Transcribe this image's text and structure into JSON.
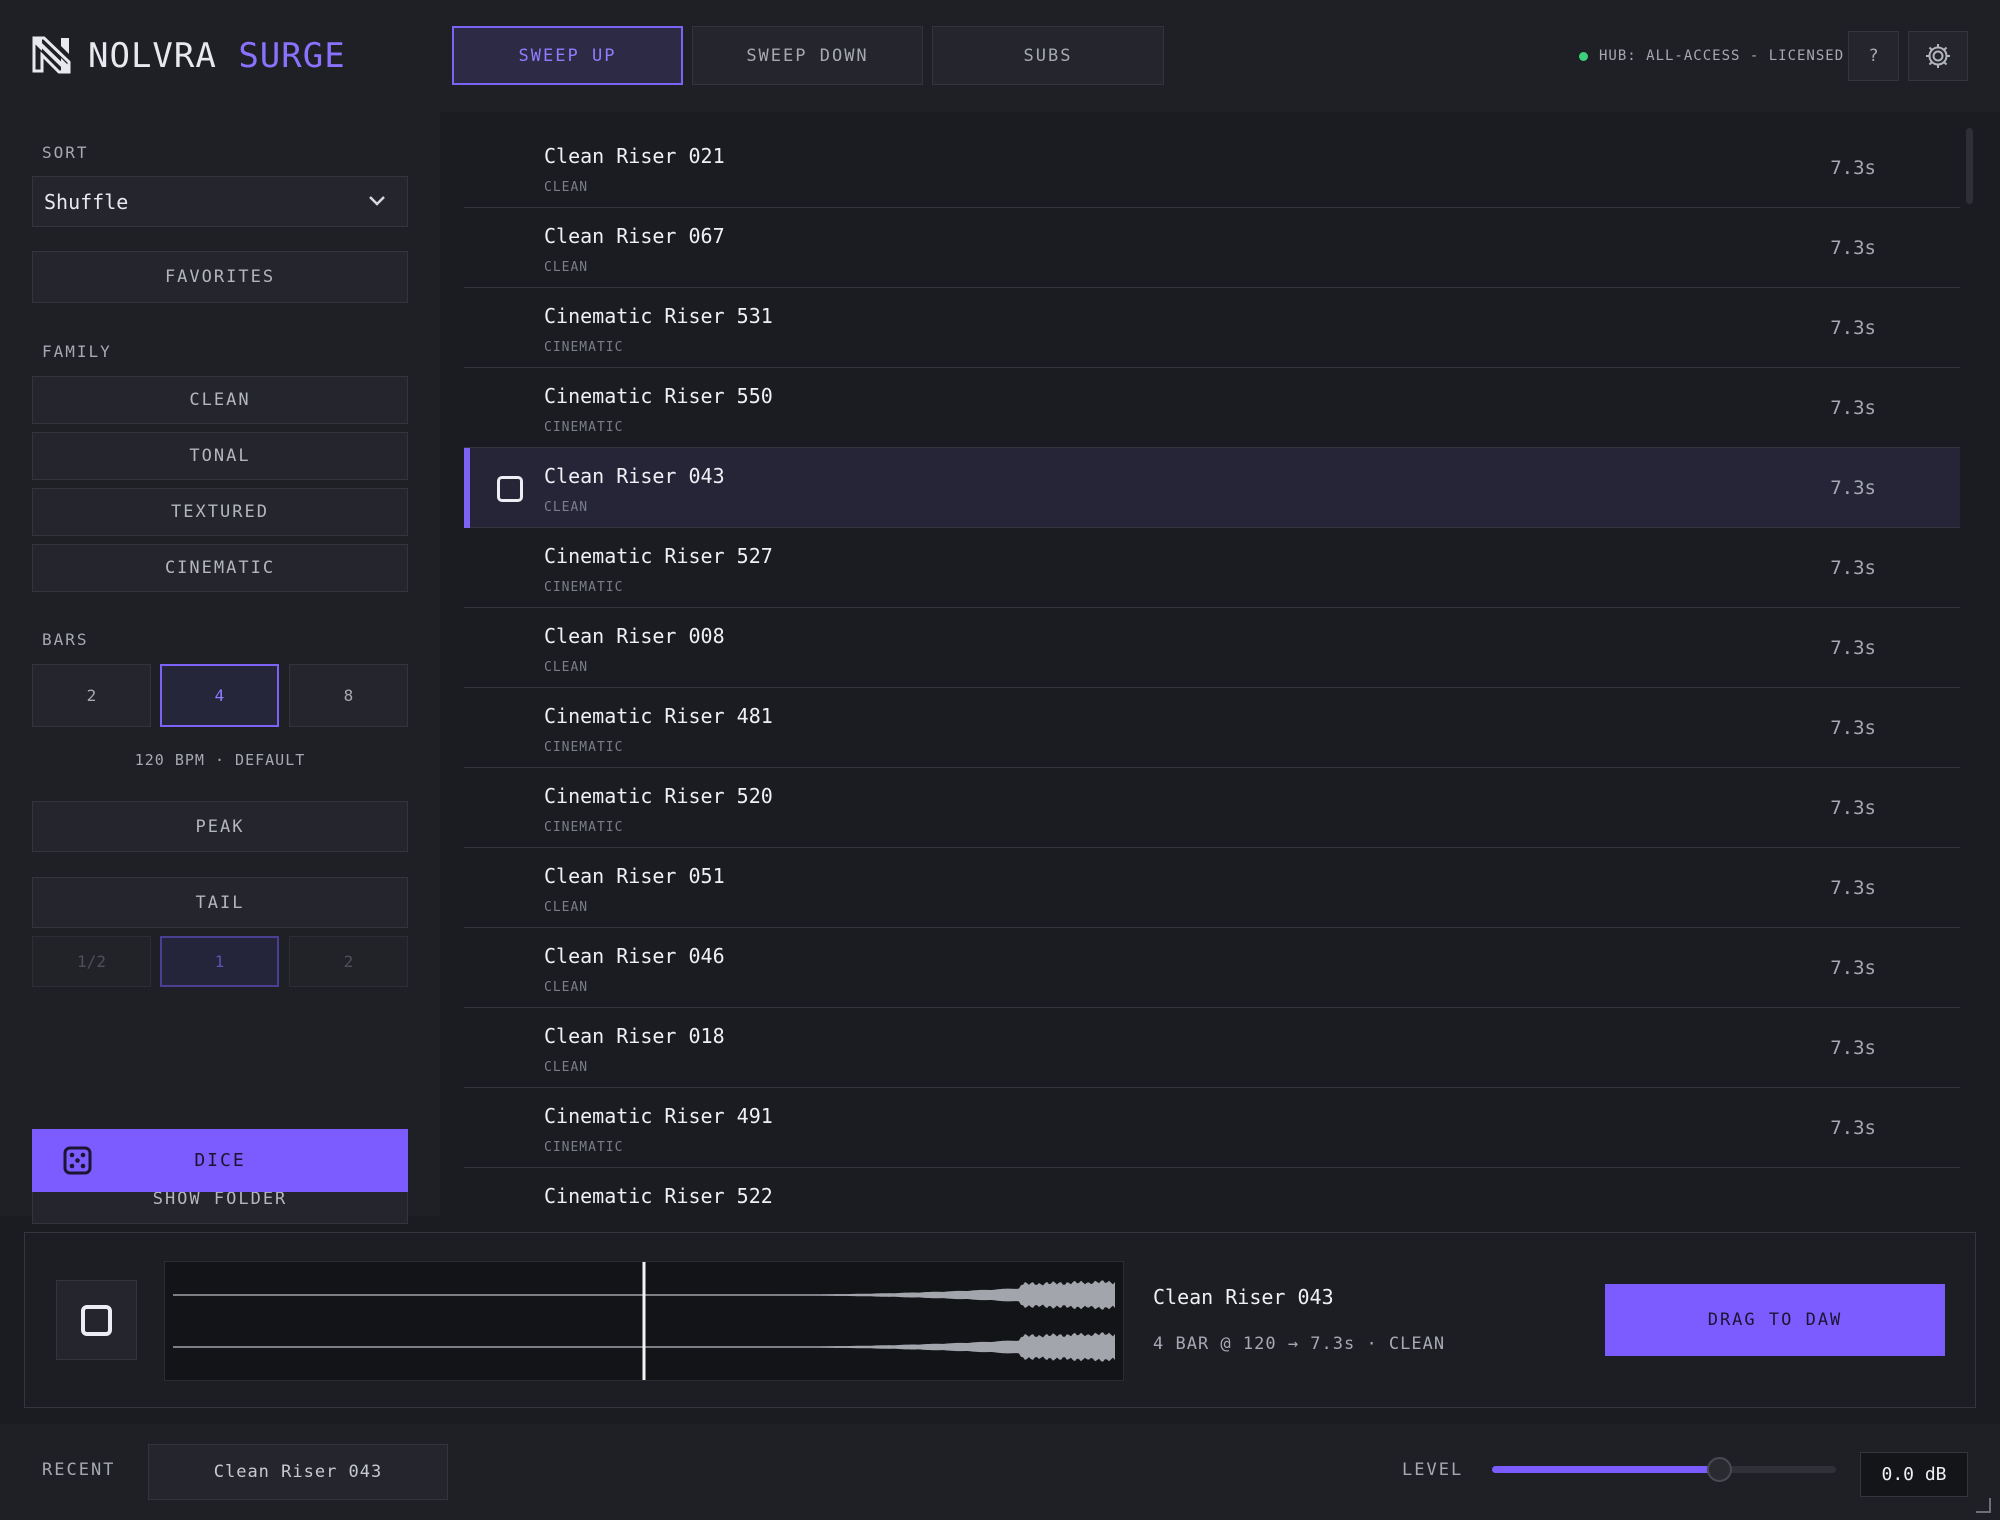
{
  "header": {
    "brand_primary": "NOLVRA",
    "brand_secondary": "SURGE",
    "tabs": [
      {
        "label": "SWEEP UP",
        "active": true
      },
      {
        "label": "SWEEP DOWN",
        "active": false
      },
      {
        "label": "SUBS",
        "active": false
      }
    ],
    "hub_status": "HUB: ALL-ACCESS - LICENSED",
    "help_label": "?",
    "settings_icon": "gear-icon"
  },
  "sidebar": {
    "sort_label": "SORT",
    "sort_value": "Shuffle",
    "favorites_label": "FAVORITES",
    "family_label": "FAMILY",
    "families": [
      "CLEAN",
      "TONAL",
      "TEXTURED",
      "CINEMATIC"
    ],
    "bars_label": "BARS",
    "bars": [
      {
        "label": "2",
        "active": false
      },
      {
        "label": "4",
        "active": true
      },
      {
        "label": "8",
        "active": false
      }
    ],
    "bpm_note": "120 BPM · DEFAULT",
    "peak_label": "PEAK",
    "tail_label": "TAIL",
    "tail_options": [
      {
        "label": "1/2",
        "active": false
      },
      {
        "label": "1",
        "active": true
      },
      {
        "label": "2",
        "active": false
      }
    ],
    "show_folder_label": "SHOW FOLDER",
    "dice_label": "DICE"
  },
  "list": {
    "items": [
      {
        "name": "Clean Riser 021",
        "family": "CLEAN",
        "duration": "7.3s",
        "selected": false
      },
      {
        "name": "Clean Riser 067",
        "family": "CLEAN",
        "duration": "7.3s",
        "selected": false
      },
      {
        "name": "Cinematic Riser 531",
        "family": "CINEMATIC",
        "duration": "7.3s",
        "selected": false
      },
      {
        "name": "Cinematic Riser 550",
        "family": "CINEMATIC",
        "duration": "7.3s",
        "selected": false
      },
      {
        "name": "Clean Riser 043",
        "family": "CLEAN",
        "duration": "7.3s",
        "selected": true
      },
      {
        "name": "Cinematic Riser 527",
        "family": "CINEMATIC",
        "duration": "7.3s",
        "selected": false
      },
      {
        "name": "Clean Riser 008",
        "family": "CLEAN",
        "duration": "7.3s",
        "selected": false
      },
      {
        "name": "Cinematic Riser 481",
        "family": "CINEMATIC",
        "duration": "7.3s",
        "selected": false
      },
      {
        "name": "Cinematic Riser 520",
        "family": "CINEMATIC",
        "duration": "7.3s",
        "selected": false
      },
      {
        "name": "Clean Riser 051",
        "family": "CLEAN",
        "duration": "7.3s",
        "selected": false
      },
      {
        "name": "Clean Riser 046",
        "family": "CLEAN",
        "duration": "7.3s",
        "selected": false
      },
      {
        "name": "Clean Riser 018",
        "family": "CLEAN",
        "duration": "7.3s",
        "selected": false
      },
      {
        "name": "Cinematic Riser 491",
        "family": "CINEMATIC",
        "duration": "7.3s",
        "selected": false
      },
      {
        "name": "Cinematic Riser 522",
        "family": "",
        "duration": "",
        "selected": false
      }
    ]
  },
  "player": {
    "track_name": "Clean Riser 043",
    "track_meta": "4 BAR @ 120 → 7.3s · CLEAN",
    "playhead_fraction": 0.5,
    "drag_label": "DRAG TO DAW"
  },
  "bottom": {
    "recent_label": "RECENT",
    "recent_item": "Clean Riser 043",
    "level_label": "LEVEL",
    "level_fraction": 0.66,
    "level_value": "0.0 dB"
  },
  "colors": {
    "accent": "#7c5cff",
    "accent_text": "#8f7cff",
    "status_ok": "#3ecf7b",
    "background": "#1b1c21"
  }
}
